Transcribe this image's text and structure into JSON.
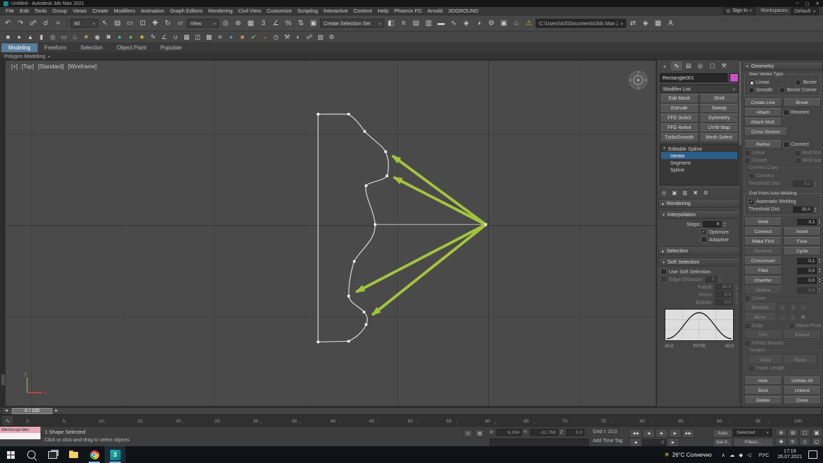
{
  "window": {
    "title": "Untitled - Autodesk 3ds Max 2021",
    "minimize": "─",
    "maximize": "▢",
    "close": "✕"
  },
  "menu": {
    "items": [
      "File",
      "Edit",
      "Tools",
      "Group",
      "Views",
      "Create",
      "Modifiers",
      "Animation",
      "Graph Editors",
      "Rendering",
      "Civil View",
      "Customize",
      "Scripting",
      "Interactive",
      "Content",
      "Help",
      "Phoenix FD",
      "Arnold",
      "3DGROUND"
    ],
    "sign_in": "Sign In",
    "workspaces_label": "Workspaces:",
    "workspace_value": "Default"
  },
  "toolbar": {
    "selection_filter": "All",
    "coordinate_system": "View",
    "selection_set_placeholder": "Create Selection Set",
    "project_path": "C:\\Users\\AS\\Documents\\3ds Max 2021",
    "row1a": [
      {
        "name": "undo-icon",
        "glyph": "↶"
      },
      {
        "name": "redo-icon",
        "glyph": "↷"
      },
      {
        "name": "select-and-link-icon",
        "glyph": "☍"
      },
      {
        "name": "unlink-selection-icon",
        "glyph": "☌"
      },
      {
        "name": "bind-to-space-warp-icon",
        "glyph": "≈"
      }
    ],
    "row1b": [
      {
        "name": "select-object-icon",
        "glyph": "↖"
      },
      {
        "name": "select-by-name-icon",
        "glyph": "▤"
      },
      {
        "name": "selection-region-icon",
        "glyph": "▭"
      },
      {
        "name": "window-crossing-icon",
        "glyph": "⊡"
      },
      {
        "name": "select-and-move-icon",
        "glyph": "✚"
      },
      {
        "name": "select-and-rotate-icon",
        "glyph": "↻"
      },
      {
        "name": "select-and-scale-icon",
        "glyph": "▱"
      }
    ],
    "row1c": [
      {
        "name": "use-pivot-center-icon",
        "glyph": "◎"
      },
      {
        "name": "select-and-manipulate-icon",
        "glyph": "⊕"
      },
      {
        "name": "keyboard-override-icon",
        "glyph": "▦"
      },
      {
        "name": "snaps-toggle-icon",
        "glyph": "3"
      },
      {
        "name": "angle-snap-icon",
        "glyph": "∠"
      },
      {
        "name": "percent-snap-icon",
        "glyph": "%"
      },
      {
        "name": "spinner-snap-icon",
        "glyph": "⇅"
      },
      {
        "name": "named-selection-sets-icon",
        "glyph": "▣"
      }
    ],
    "row1d": [
      {
        "name": "mirror-icon",
        "glyph": "◧"
      },
      {
        "name": "align-icon",
        "glyph": "≡"
      },
      {
        "name": "scene-explorer-icon",
        "glyph": "▤"
      },
      {
        "name": "layer-explorer-icon",
        "glyph": "▥"
      },
      {
        "name": "ribbon-toggle-icon",
        "glyph": "▬"
      },
      {
        "name": "curve-editor-icon",
        "glyph": "∿"
      },
      {
        "name": "schematic-view-icon",
        "glyph": "◈"
      },
      {
        "name": "material-editor-icon",
        "glyph": "◑"
      },
      {
        "name": "render-setup-icon",
        "glyph": "⚙"
      },
      {
        "name": "rendered-frame-icon",
        "glyph": "▣"
      },
      {
        "name": "render-production-icon",
        "glyph": "♨"
      },
      {
        "name": "warning-icon",
        "glyph": "⚠",
        "color": "#d8b91f"
      }
    ],
    "row1e": [
      {
        "name": "scene-converter-icon",
        "glyph": "⇄"
      },
      {
        "name": "state-sets-icon",
        "glyph": "◈"
      },
      {
        "name": "grid-tools-icon",
        "glyph": "▦"
      },
      {
        "name": "arnold-menu-icon",
        "glyph": "A"
      }
    ],
    "row2": [
      {
        "name": "box-primitive-icon",
        "glyph": "■"
      },
      {
        "name": "sphere-primitive-icon",
        "glyph": "●"
      },
      {
        "name": "cone-primitive-icon",
        "glyph": "▲"
      },
      {
        "name": "cylinder-primitive-icon",
        "glyph": "▮"
      },
      {
        "name": "torus-primitive-icon",
        "glyph": "◎"
      },
      {
        "name": "plane-primitive-icon",
        "glyph": "▭"
      },
      {
        "name": "teapot-icon",
        "glyph": "♨"
      },
      {
        "name": "light-icon",
        "glyph": "☀",
        "color": "#e0ce4a"
      },
      {
        "name": "camera-icon",
        "glyph": "◉"
      },
      {
        "name": "helpers-icon",
        "glyph": "✖"
      },
      {
        "name": "sphere-teal-icon",
        "glyph": "●",
        "color": "#49b3a4"
      },
      {
        "name": "sphere-green-icon",
        "glyph": "●",
        "color": "#82b44c"
      },
      {
        "name": "star-icon",
        "glyph": "★",
        "color": "#dfc12c"
      },
      {
        "name": "paint-icon",
        "glyph": "✎"
      },
      {
        "name": "measure-icon",
        "glyph": "∠"
      },
      {
        "name": "magnet-snap-icon",
        "glyph": "∪"
      },
      {
        "name": "grid-helper-icon",
        "glyph": "▦"
      },
      {
        "name": "mirror-tool-icon",
        "glyph": "◫"
      },
      {
        "name": "array-tool-icon",
        "glyph": "▩"
      },
      {
        "name": "align-tool-icon",
        "glyph": "≡"
      },
      {
        "name": "sphere-blue-icon",
        "glyph": "●",
        "color": "#5890c8"
      },
      {
        "name": "cube-orange-icon",
        "glyph": "■",
        "color": "#cf8b4b"
      },
      {
        "name": "check-green-icon",
        "glyph": "✔",
        "color": "#7cb84e"
      },
      {
        "name": "rgb-channels-icon",
        "glyph": "◒",
        "color": "#c85050"
      },
      {
        "name": "clock-icon",
        "glyph": "◷"
      },
      {
        "name": "wrench-icon",
        "glyph": "⚒"
      },
      {
        "name": "globe-icon",
        "glyph": "◐"
      },
      {
        "name": "link-tool-icon",
        "glyph": "☍"
      },
      {
        "name": "layers-icon",
        "glyph": "▥"
      },
      {
        "name": "settings-icon",
        "glyph": "⚙"
      }
    ]
  },
  "ribbon": {
    "tabs": [
      {
        "label": "Modeling",
        "active": true
      },
      {
        "label": "Freeform"
      },
      {
        "label": "Selection"
      },
      {
        "label": "Object Paint"
      },
      {
        "label": "Populate"
      }
    ],
    "strip": "Polygon Modeling"
  },
  "viewport": {
    "labels": [
      {
        "name": "viewport-menu-plus",
        "label": "[+]"
      },
      {
        "name": "viewport-menu-view",
        "label": "[Top]"
      },
      {
        "name": "viewport-menu-visual",
        "label": "[Standard]"
      },
      {
        "name": "viewport-menu-shading",
        "label": "[Wireframe]"
      }
    ]
  },
  "command_panel": {
    "tabs": [
      {
        "name": "create-tab-icon",
        "glyph": "+"
      },
      {
        "name": "modify-tab-icon",
        "glyph": "∿",
        "active": true
      },
      {
        "name": "hierarchy-tab-icon",
        "glyph": "▤"
      },
      {
        "name": "motion-tab-icon",
        "glyph": "◎"
      },
      {
        "name": "display-tab-icon",
        "glyph": "▢"
      },
      {
        "name": "utilities-tab-icon",
        "glyph": "⚒"
      }
    ],
    "object_name": "Rectangle001",
    "modifier_list_label": "Modifier List",
    "modifier_buttons": [
      "Edit Mesh",
      "Shell",
      "Extrude",
      "Sweep",
      "FFD 3x3x3",
      "Symmetry",
      "FFD 4x4x4",
      "UVW Map",
      "TurboSmooth",
      "Mesh Select"
    ],
    "stack": {
      "root": "Editable Spline",
      "items": [
        {
          "label": "Vertex",
          "active": true
        },
        {
          "label": "Segment"
        },
        {
          "label": "Spline"
        }
      ]
    },
    "stack_tools": [
      {
        "name": "pin-stack-icon",
        "glyph": "◎"
      },
      {
        "name": "show-end-result-icon",
        "glyph": "▣"
      },
      {
        "name": "make-unique-icon",
        "glyph": "▥"
      },
      {
        "name": "remove-modifier-icon",
        "glyph": "✖"
      },
      {
        "name": "configure-modifier-sets-icon",
        "glyph": "⚙"
      }
    ],
    "rollouts": {
      "rendering": "Rendering",
      "interpolation": "Interpolation",
      "steps_label": "Steps:",
      "steps_value": "6",
      "optimize": "Optimize",
      "adaptive": "Adaptive",
      "selection": "Selection",
      "soft_selection": "Soft Selection",
      "use_soft_selection": "Use Soft Selection",
      "edge_distance": "Edge Distance:",
      "edge_distance_value": "1",
      "falloff": "Falloff:",
      "falloff_value": "20,0",
      "pinch": "Pinch:",
      "pinch_value": "0,0",
      "bubble": "Bubble:",
      "bubble_value": "0,0",
      "curve_left": "20,0",
      "curve_center": "0'0\"00",
      "curve_right": "20,0"
    }
  },
  "geometry": {
    "title": "Geometry",
    "new_vertex_type": "New Vertex Type",
    "linear": "Linear",
    "smooth": "Smooth",
    "bezier": "Bezier",
    "bezier_corner": "Bezier Corner",
    "create_line": "Create Line",
    "break_btn": "Break",
    "attach": "Attach",
    "reorient": "Reorient",
    "attach_mult": "Attach Mult.",
    "cross_section": "Cross Section",
    "refine": "Refine",
    "connect_chk": "Connect",
    "linear_chk": "Linear",
    "bind_first": "Bind first",
    "closed": "Closed",
    "bind_last": "Bind last",
    "connect_copy": "Connect Copy",
    "connect2": "Connect",
    "threshold_label": "Threshold Dist.",
    "threshold1": "0,1",
    "end_point": "End Point Auto-Welding",
    "auto_weld": "Automatic Welding",
    "threshold2": "30,0",
    "weld": "Weld",
    "weld_val": "3,1",
    "connect_btn": "Connect",
    "insert": "Insert",
    "make_first": "Make First",
    "fuse": "Fuse",
    "reverse": "Reverse",
    "cycle": "Cycle",
    "cross_insert": "CrossInsert",
    "cross_insert_val": "0,1",
    "fillet": "Fillet",
    "fillet_val": "0,0",
    "chamfer": "Chamfer",
    "chamfer_val": "0,0",
    "outline": "Outline",
    "outline_val": "0,0",
    "center": "Center",
    "boolean_label": "Boolean",
    "mirror_label": "Mirror",
    "boolean_icons": [
      {
        "name": "boolean-union-icon",
        "glyph": "∪"
      },
      {
        "name": "boolean-subtract-icon",
        "glyph": "∖"
      },
      {
        "name": "boolean-intersect-icon",
        "glyph": "∩"
      }
    ],
    "mirror_icons": [
      {
        "name": "mirror-horizontal-icon",
        "glyph": "↔"
      },
      {
        "name": "mirror-vertical-icon",
        "glyph": "↕"
      },
      {
        "name": "mirror-both-icon",
        "glyph": "✚"
      }
    ],
    "copy_chk": "Copy",
    "about_pivot": "About Pivot",
    "trim": "Trim",
    "extend": "Extend",
    "infinite_bounds": "Infinite Bounds",
    "tangent": "Tangent",
    "tan_copy": "Copy",
    "tan_paste": "Paste",
    "paste_length": "Paste Length",
    "hide": "Hide",
    "unhide_all": "Unhide All",
    "bind": "Bind",
    "unbind": "Unbind",
    "delete_btn": "Delete",
    "close_btn": "Close"
  },
  "timeline": {
    "slider": "0 / 100",
    "ticks": [
      "0",
      "5",
      "10",
      "15",
      "20",
      "25",
      "30",
      "35",
      "40",
      "45",
      "50",
      "55",
      "60",
      "65",
      "70",
      "75",
      "80",
      "85",
      "90",
      "95",
      "100"
    ]
  },
  "status_bar": {
    "listener_label": "MAXScript Mini",
    "status": "1 Shape Selected",
    "prompt": "Click or click-and-drag to select objects",
    "x_label": "X:",
    "x_value": "6,294",
    "y_label": "Y:",
    "y_value": "-11,768",
    "z_label": "Z:",
    "z_value": "0,0",
    "grid": "Grid = 10,0",
    "add_time_tag": "Add Time Tag",
    "frame": "0",
    "auto_key": "Auto",
    "set_key": "Set K.",
    "selected": "Selected",
    "key_filters": "Filters...",
    "mini_icons": [
      {
        "name": "isolate-selection-icon",
        "glyph": "⊙"
      },
      {
        "name": "selection-lock-icon",
        "glyph": "⊠"
      }
    ],
    "transport": [
      {
        "name": "go-to-start-icon",
        "glyph": "◀◀"
      },
      {
        "name": "previous-frame-icon",
        "glyph": "◀"
      },
      {
        "name": "play-animation-icon",
        "glyph": "▶"
      },
      {
        "name": "next-frame-icon",
        "glyph": "▶"
      },
      {
        "name": "go-to-end-icon",
        "glyph": "▶▶"
      }
    ],
    "key_nav": [
      {
        "name": "previous-key-icon",
        "glyph": "◀"
      },
      {
        "name": "next-key-icon",
        "glyph": "▶"
      }
    ],
    "nav_icons": [
      {
        "name": "zoom-icon",
        "glyph": "⊕"
      },
      {
        "name": "zoom-all-icon",
        "glyph": "⊞"
      },
      {
        "name": "zoom-extents-icon",
        "glyph": "▢"
      },
      {
        "name": "zoom-extents-all-icon",
        "glyph": "▣"
      },
      {
        "name": "pan-view-icon",
        "glyph": "✚"
      },
      {
        "name": "orbit-icon",
        "glyph": "↻"
      },
      {
        "name": "field-of-view-icon",
        "glyph": "◇"
      },
      {
        "name": "maximize-viewport-icon",
        "glyph": "◱"
      }
    ]
  },
  "taskbar": {
    "weather": "26°C Солнечно",
    "lang": "РУС",
    "time": "17:19",
    "date": "26.07.2021",
    "tray_icons": [
      {
        "name": "hidden-icons-chevron-icon",
        "glyph": "∧"
      },
      {
        "name": "onedrive-icon",
        "glyph": "☁"
      },
      {
        "name": "shield-icon",
        "glyph": "◆"
      },
      {
        "name": "volume-icon",
        "glyph": "◁"
      }
    ]
  }
}
